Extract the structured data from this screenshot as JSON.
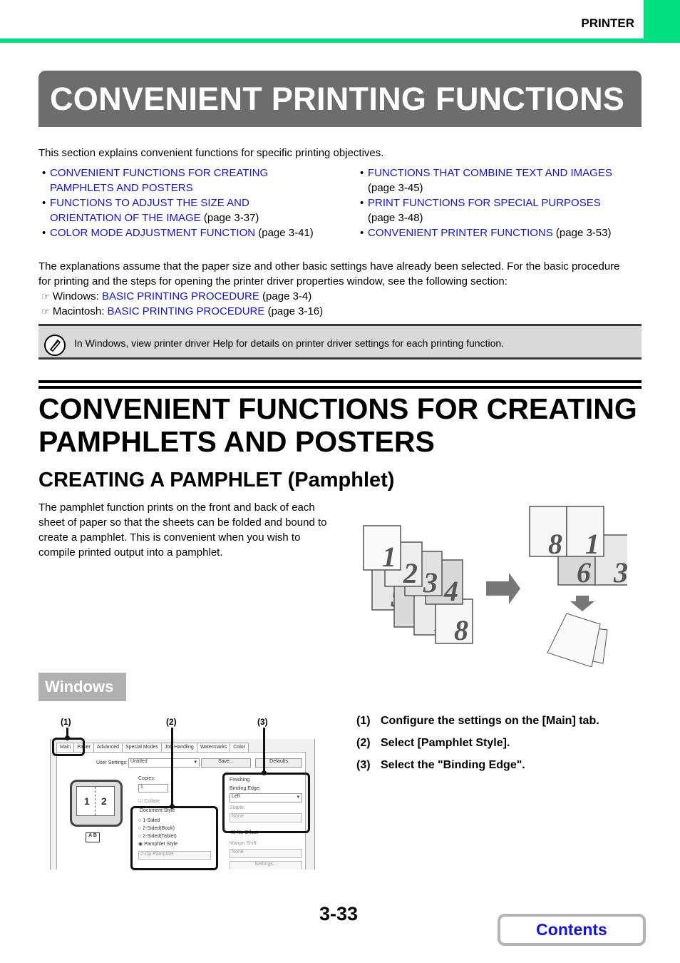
{
  "header": {
    "section": "PRINTER",
    "accent_color": "#00e07f"
  },
  "page_title": "CONVENIENT PRINTING FUNCTIONS",
  "intro": "This section explains convenient functions for specific printing objectives.",
  "toc_left": [
    {
      "link": "CONVENIENT FUNCTIONS FOR CREATING PAMPHLETS AND POSTERS",
      "page": ""
    },
    {
      "link": "FUNCTIONS TO ADJUST THE SIZE AND ORIENTATION OF THE IMAGE",
      "page": " (page 3-37)"
    },
    {
      "link": "COLOR MODE ADJUSTMENT FUNCTION",
      "page": " (page 3-41)"
    }
  ],
  "toc_right": [
    {
      "link": "FUNCTIONS THAT COMBINE TEXT AND IMAGES",
      "page": " (page 3-45)"
    },
    {
      "link": "PRINT FUNCTIONS FOR SPECIAL PURPOSES",
      "page": " (page 3-48)"
    },
    {
      "link": "CONVENIENT PRINTER FUNCTIONS",
      "page": " (page 3-53)"
    }
  ],
  "explanation": "The explanations assume that the paper size and other basic settings have already been selected. For the basic procedure for printing and the steps for opening the printer driver properties window, see the following section:",
  "refs": [
    {
      "prefix": "Windows: ",
      "link": "BASIC PRINTING PROCEDURE",
      "page": " (page 3-4)"
    },
    {
      "prefix": "Macintosh: ",
      "link": "BASIC PRINTING PROCEDURE",
      "page": " (page 3-16)"
    }
  ],
  "note": "In Windows, view printer driver Help for details on printer driver settings for each printing function.",
  "section_heading": "CONVENIENT FUNCTIONS FOR CREATING PAMPHLETS AND POSTERS",
  "subheading": "CREATING A PAMPHLET (Pamphlet)",
  "description": "The pamphlet function prints on the front and back of each sheet of paper so that the sheets can be folded and bound to create a pamphlet. This is convenient when you wish to compile printed output into a pamphlet.",
  "illustration": {
    "source_pages": [
      "1",
      "2",
      "3",
      "4",
      "5",
      "6",
      "7",
      "8"
    ],
    "sheet_front": [
      "8",
      "1"
    ],
    "sheet_back": [
      "6",
      "3"
    ]
  },
  "os_label": "Windows",
  "driver": {
    "tabs": [
      "Main",
      "Paper",
      "Advanced",
      "Special Modes",
      "Job Handling",
      "Watermarks",
      "Color"
    ],
    "user_settings_label": "User Settings:",
    "user_settings_value": "Untitled",
    "save_btn": "Save...",
    "defaults_btn": "Defaults",
    "copies_label": "Copies:",
    "copies_value": "1",
    "collate": "Collate",
    "doc_style_label": "Document Style",
    "doc_style_options": [
      "1-Sided",
      "2-Sided(Book)",
      "2-Sided(Tablet)",
      "Pamphlet Style"
    ],
    "doc_style_selected": "Pamphlet Style",
    "pamphlet_select": "2-Up Pamphlet",
    "finishing_label": "Finishing",
    "binding_edge_label": "Binding Edge:",
    "binding_edge_value": "Left",
    "staple_label": "Staple:",
    "staple_value": "None",
    "no_offset": "No Offset",
    "margin_shift_label": "Margin Shift:",
    "margin_shift_value": "None",
    "settings_btn": "Settings...",
    "preview_pages": [
      "1",
      "2"
    ],
    "callouts": [
      "(1)",
      "(2)",
      "(3)"
    ]
  },
  "steps": [
    {
      "num": "(1)",
      "text": "Configure the settings on the [Main] tab."
    },
    {
      "num": "(2)",
      "text": "Select [Pamphlet Style]."
    },
    {
      "num": "(3)",
      "text": "Select the \"Binding Edge\"."
    }
  ],
  "footer": {
    "page_number": "3-33",
    "contents_button": "Contents"
  }
}
